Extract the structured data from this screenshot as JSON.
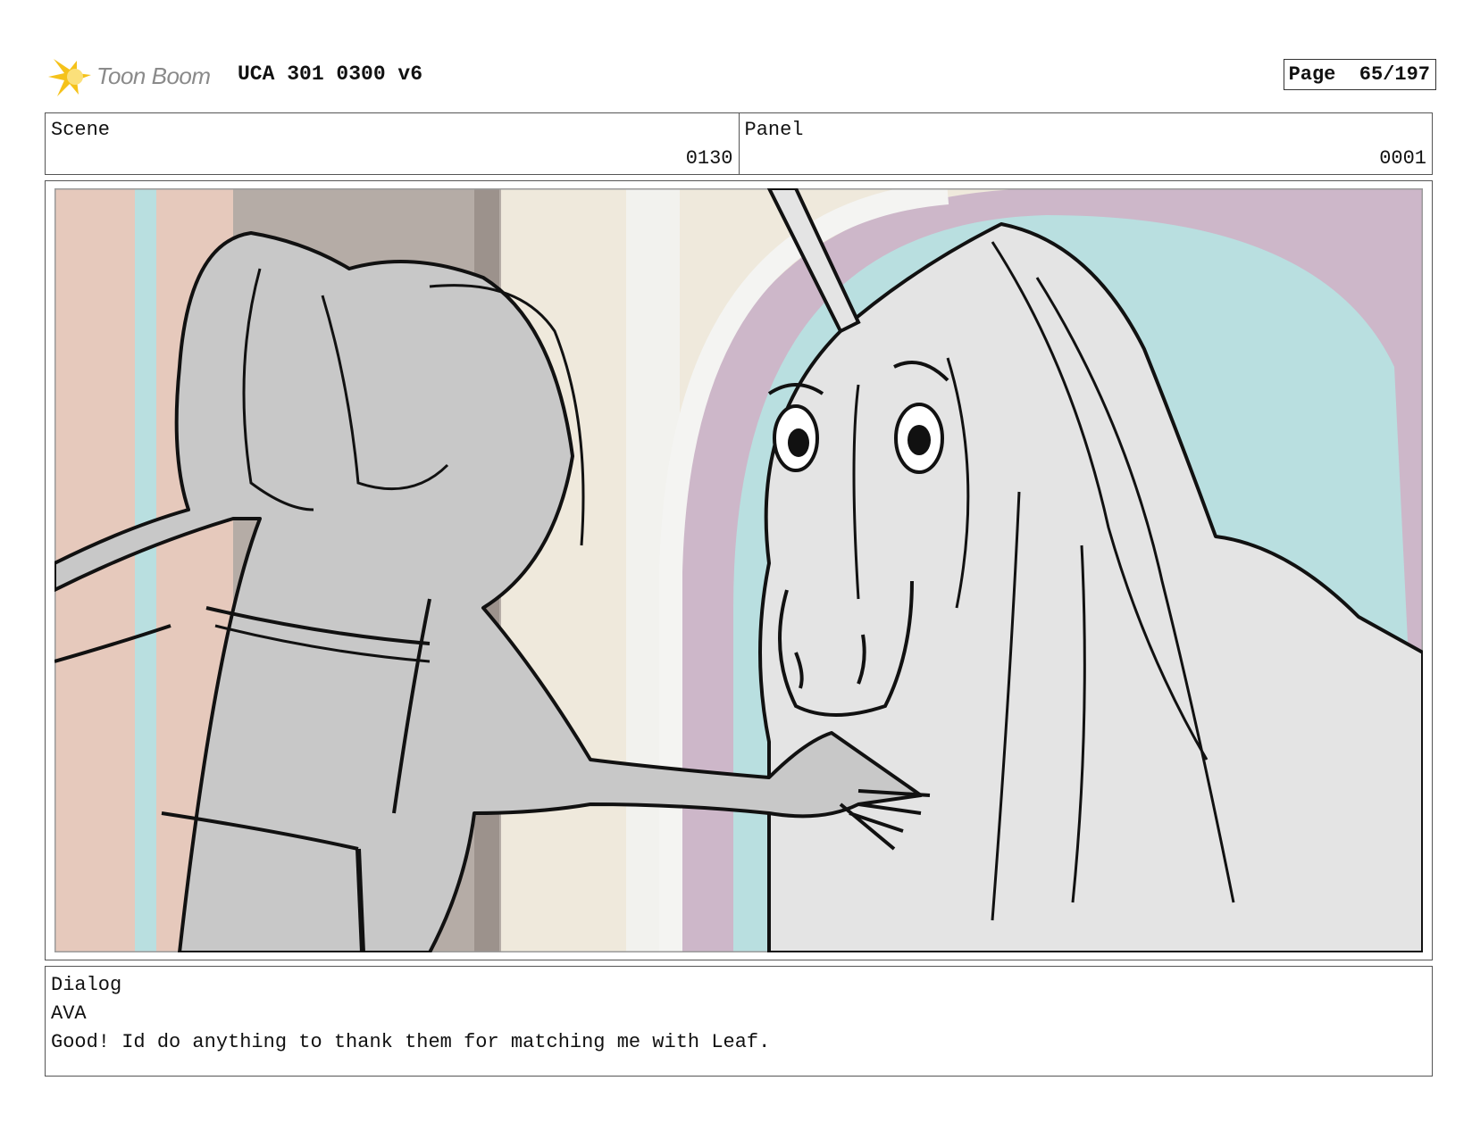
{
  "header": {
    "logo_text": "Toon Boom",
    "doc_title": "UCA 301 0300 v6",
    "page_label": "Page",
    "page_number": "65/197"
  },
  "info": {
    "scene_label": "Scene",
    "scene_value": "0130",
    "panel_label": "Panel",
    "panel_value": "0001"
  },
  "dialog": {
    "label": "Dialog",
    "speaker": "AVA",
    "line": "Good! Id do anything to thank them for matching me with Leaf."
  },
  "colors": {
    "logo_star": "#f5c21a",
    "bg_pink": "#e6c9bc",
    "bg_teal": "#b9dfe0",
    "bg_mauve": "#cdb7c9",
    "bg_cream": "#efe9dc",
    "girl_gray": "#c8c8c8",
    "unicorn_gray": "#e4e4e4"
  }
}
